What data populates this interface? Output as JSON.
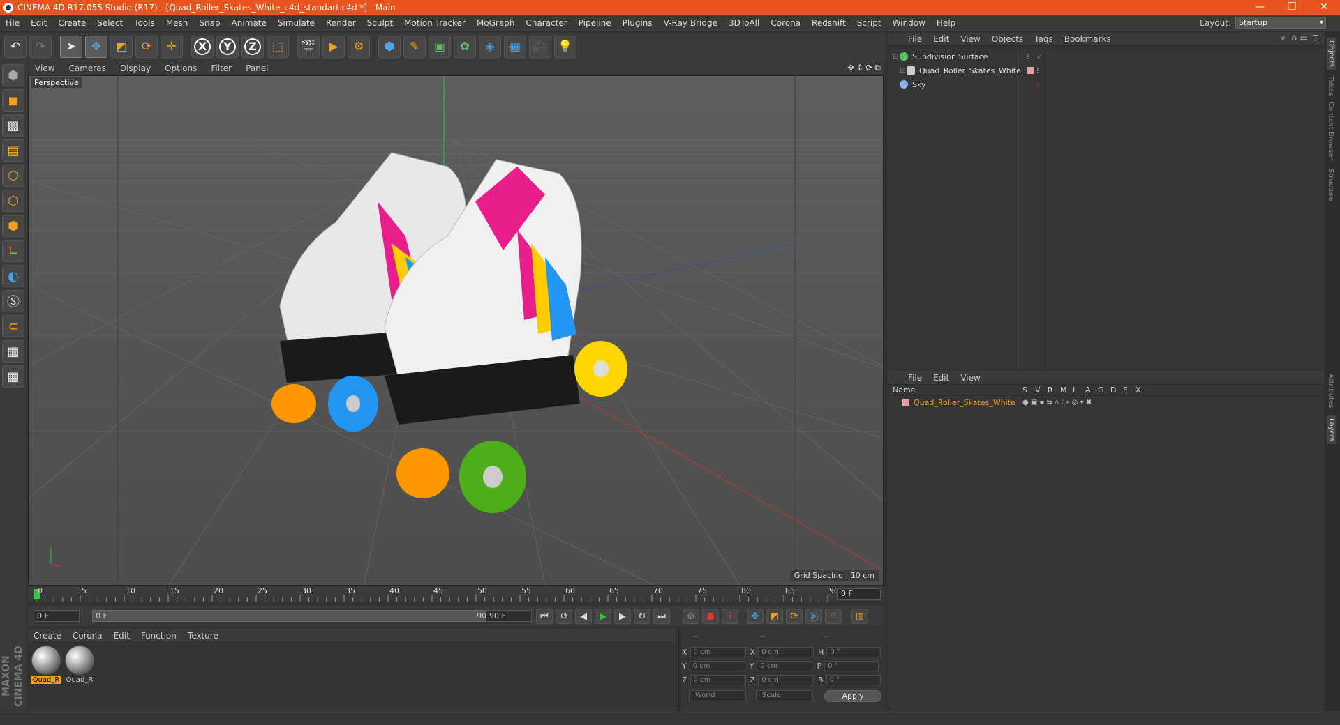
{
  "window": {
    "title": "CINEMA 4D R17.055 Studio (R17) - [Quad_Roller_Skates_White_c4d_standart.c4d *] - Main",
    "minimize": "—",
    "maximize": "❐",
    "close": "✕"
  },
  "menubar": {
    "items": [
      "File",
      "Edit",
      "Create",
      "Select",
      "Tools",
      "Mesh",
      "Snap",
      "Animate",
      "Simulate",
      "Render",
      "Sculpt",
      "Motion Tracker",
      "MoGraph",
      "Character",
      "Pipeline",
      "Plugins",
      "V-Ray Bridge",
      "3DToAll",
      "Corona",
      "Redshift",
      "Script",
      "Window",
      "Help"
    ],
    "layout_label": "Layout:",
    "layout_value": "Startup"
  },
  "viewport": {
    "menu": [
      "View",
      "Cameras",
      "Display",
      "Options",
      "Filter",
      "Panel"
    ],
    "label": "Perspective",
    "grid_spacing": "Grid Spacing : 10 cm"
  },
  "timeline": {
    "ticks": [
      "0",
      "5",
      "10",
      "15",
      "20",
      "25",
      "30",
      "35",
      "40",
      "45",
      "50",
      "55",
      "60",
      "65",
      "70",
      "75",
      "80",
      "85",
      "90"
    ],
    "current_frame": "0 F"
  },
  "transport": {
    "start": "0 F",
    "range_start": "0 F",
    "range_end": "90 F",
    "end": "90 F"
  },
  "materials": {
    "menu": [
      "Create",
      "Corona",
      "Edit",
      "Function",
      "Texture"
    ],
    "items": [
      {
        "label": "Quad_R",
        "selected": true
      },
      {
        "label": "Quad_R",
        "selected": false
      }
    ]
  },
  "coordinates": {
    "headers": [
      "--",
      "--",
      "--"
    ],
    "rows": [
      {
        "a": "X",
        "av": "0 cm",
        "b": "X",
        "bv": "0 cm",
        "c": "H",
        "cv": "0 °"
      },
      {
        "a": "Y",
        "av": "0 cm",
        "b": "Y",
        "bv": "0 cm",
        "c": "P",
        "cv": "0 °"
      },
      {
        "a": "Z",
        "av": "0 cm",
        "b": "Z",
        "bv": "0 cm",
        "c": "B",
        "cv": "0 °"
      }
    ],
    "mode": "World",
    "scale": "Scale",
    "apply": "Apply"
  },
  "objects": {
    "menu": [
      "File",
      "Edit",
      "View",
      "Objects",
      "Tags",
      "Bookmarks"
    ],
    "items": [
      {
        "name": "Subdivision Surface",
        "color": "#59c36a"
      },
      {
        "name": "Quad_Roller_Skates_White",
        "color": "#cccccc"
      },
      {
        "name": "Sky",
        "color": "#8ab4e8"
      }
    ]
  },
  "layers": {
    "menu": [
      "File",
      "Edit",
      "View"
    ],
    "columns": [
      "Name",
      "S",
      "V",
      "R",
      "M",
      "L",
      "A",
      "G",
      "D",
      "E",
      "X"
    ],
    "row_name": "Quad_Roller_Skates_White",
    "row_color": "#e8a0a8"
  },
  "right_tabs": [
    "Objects",
    "Takes",
    "Content Browser",
    "Structure",
    "Attributes",
    "Layers"
  ],
  "brand": "MAXON CINEMA 4D",
  "accent_color": "#e8541e"
}
